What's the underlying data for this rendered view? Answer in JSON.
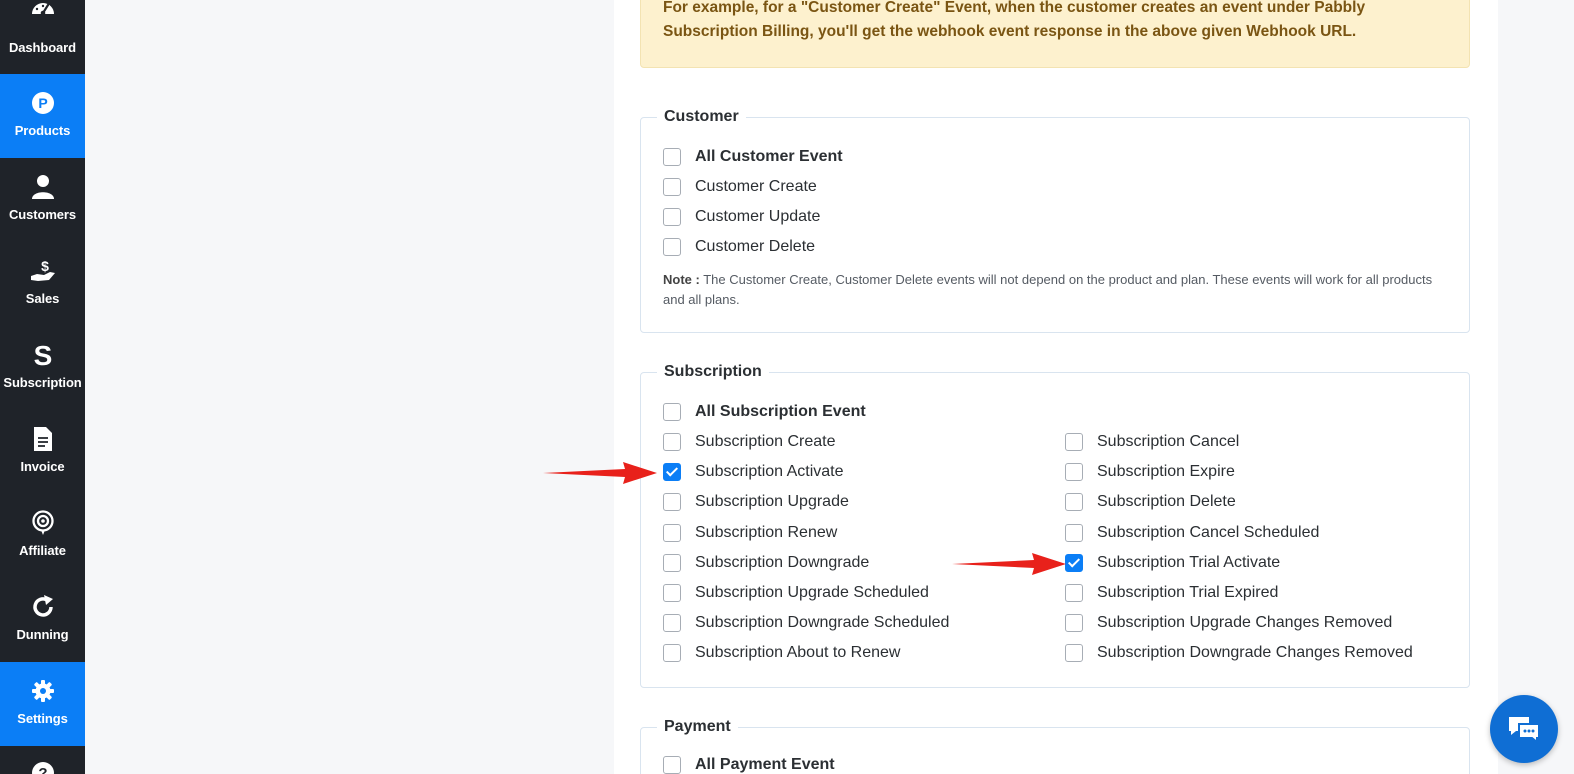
{
  "sidebar": {
    "items": [
      {
        "label": "Dashboard",
        "icon": "dashboard-icon"
      },
      {
        "label": "Products",
        "icon": "products-icon",
        "active": true
      },
      {
        "label": "Customers",
        "icon": "customers-icon"
      },
      {
        "label": "Sales",
        "icon": "sales-icon"
      },
      {
        "label": "Subscription",
        "icon": "subscription-icon"
      },
      {
        "label": "Invoice",
        "icon": "invoice-icon"
      },
      {
        "label": "Affiliate",
        "icon": "affiliate-icon"
      },
      {
        "label": "Dunning",
        "icon": "dunning-icon"
      },
      {
        "label": "Settings",
        "icon": "settings-icon",
        "active": true
      },
      {
        "label": "",
        "icon": "help-icon"
      }
    ]
  },
  "notice": {
    "line1": "For example, for a \"Customer Create\" Event, when the customer creates an event under Pabbly",
    "line2": "Subscription Billing, you'll get the webhook event response in the above given Webhook URL."
  },
  "customer": {
    "title": "Customer",
    "all": "All Customer Event",
    "items": [
      "Customer Create",
      "Customer Update",
      "Customer Delete"
    ],
    "note_label": "Note :",
    "note_text": "The Customer Create, Customer Delete events will not depend on the product and plan. These events will work for all products and all plans."
  },
  "subscription": {
    "title": "Subscription",
    "all": "All Subscription Event",
    "left": [
      {
        "label": "Subscription Create",
        "checked": false
      },
      {
        "label": "Subscription Activate",
        "checked": true
      },
      {
        "label": "Subscription Upgrade",
        "checked": false
      },
      {
        "label": "Subscription Renew",
        "checked": false
      },
      {
        "label": "Subscription Downgrade",
        "checked": false
      },
      {
        "label": "Subscription Upgrade Scheduled",
        "checked": false
      },
      {
        "label": "Subscription Downgrade Scheduled",
        "checked": false
      },
      {
        "label": "Subscription About to Renew",
        "checked": false
      }
    ],
    "right": [
      {
        "label": "Subscription Cancel",
        "checked": false
      },
      {
        "label": "Subscription Expire",
        "checked": false
      },
      {
        "label": "Subscription Delete",
        "checked": false
      },
      {
        "label": "Subscription Cancel Scheduled",
        "checked": false
      },
      {
        "label": "Subscription Trial Activate",
        "checked": true
      },
      {
        "label": "Subscription Trial Expired",
        "checked": false
      },
      {
        "label": "Subscription Upgrade Changes Removed",
        "checked": false
      },
      {
        "label": "Subscription Downgrade Changes Removed",
        "checked": false
      }
    ]
  },
  "payment": {
    "title": "Payment",
    "all": "All Payment Event"
  },
  "colors": {
    "accent": "#0b7ef6",
    "sidebar": "#1f2329",
    "arrow": "#e8211b"
  }
}
